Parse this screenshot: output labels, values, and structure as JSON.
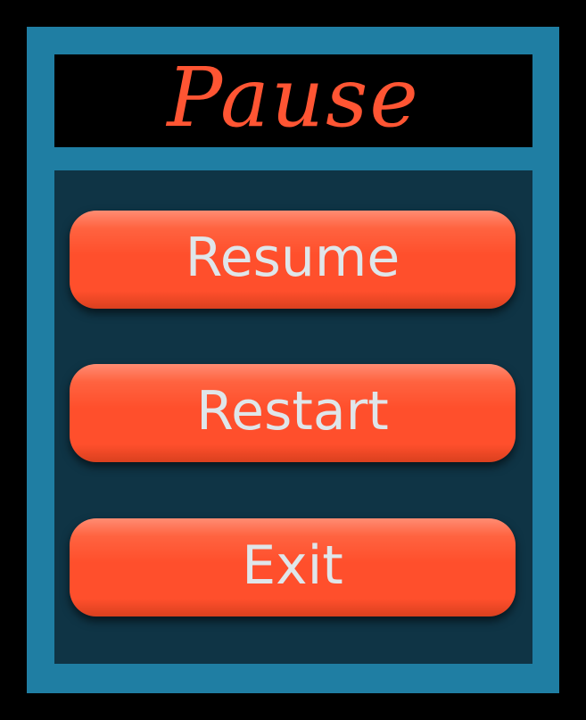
{
  "title": "Pause",
  "buttons": {
    "resume": "Resume",
    "restart": "Restart",
    "exit": "Exit"
  },
  "colors": {
    "background": "#000000",
    "frame": "#1f7ea3",
    "panel": "#0f3445",
    "title_text": "#ff5533",
    "button": "#ff4f2c",
    "button_text": "#dfe6ea"
  }
}
